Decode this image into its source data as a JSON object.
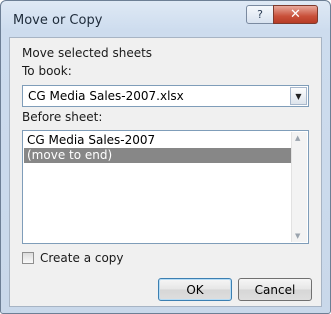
{
  "dialog": {
    "title": "Move or Copy",
    "help_glyph": "?",
    "close_glyph": "✕",
    "section_label": "Move selected sheets",
    "to_book_label": "To book:",
    "to_book_value": "CG Media Sales-2007.xlsx",
    "dropdown_glyph": "▼",
    "before_sheet_label": "Before sheet:",
    "sheets": [
      {
        "label": "CG Media Sales-2007",
        "selected": false
      },
      {
        "label": "(move to end)",
        "selected": true
      }
    ],
    "scroll_up_glyph": "▲",
    "scroll_down_glyph": "▼",
    "create_copy_label": "Create a copy",
    "create_copy_checked": false,
    "ok_label": "OK",
    "cancel_label": "Cancel"
  }
}
